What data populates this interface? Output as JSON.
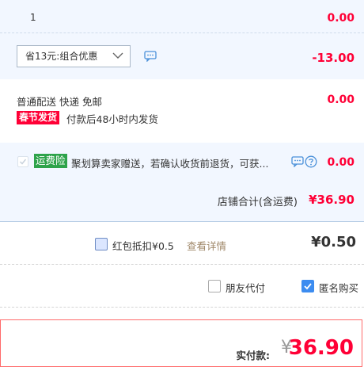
{
  "item_row": {
    "quantity": "1",
    "amount": "0.00"
  },
  "discount": {
    "selected": "省13元:组合优惠",
    "amount": "-13.00"
  },
  "delivery": {
    "method": "普通配送 快递 免邮",
    "tag": "春节发货",
    "note": "付款后48小时内发货",
    "amount": "0.00"
  },
  "insurance": {
    "tag": "运费险",
    "description": "聚划算卖家赠送，若确认收货前退货，可获...",
    "amount": "0.00"
  },
  "shop_total": {
    "label": "店铺合计(含运费)",
    "amount": "¥36.90"
  },
  "red_envelope": {
    "label": "红包抵扣¥0.5",
    "link": "查看详情",
    "amount": "¥0.50"
  },
  "options": {
    "friend_pay": "朋友代付",
    "anonymous": "匿名购买"
  },
  "payment": {
    "label": "实付款:",
    "currency": "¥",
    "total": "36.90"
  },
  "colors": {
    "accent_red": "#ff0036",
    "panel_blue": "#f2f7ff",
    "check_blue": "#3c8cf0",
    "green_tag": "#2ea34b"
  }
}
